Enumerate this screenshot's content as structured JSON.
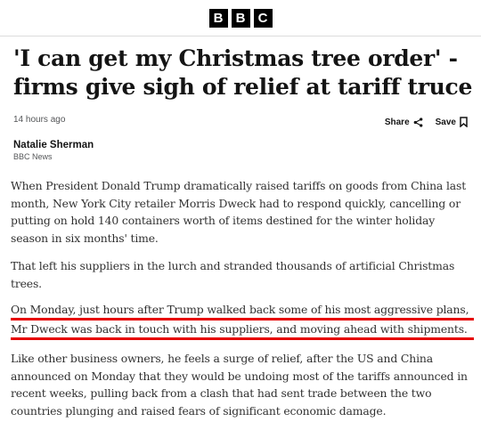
{
  "header": {
    "logo_letters": [
      "B",
      "B",
      "C"
    ]
  },
  "article": {
    "headline_line1": "'I can get my Christmas tree order' -",
    "headline_line2": "firms give sigh of relief at tariff truce",
    "timestamp": "14 hours ago",
    "share_label": "Share",
    "save_label": "Save",
    "author": "Natalie Sherman",
    "organisation": "BBC News",
    "paragraphs": [
      "When President Donald Trump dramatically raised tariffs on goods from China last month, New York City retailer Morris Dweck had to respond quickly, cancelling or putting on hold 140 containers worth of items destined for the winter holiday season in six months' time.",
      "That left his suppliers in the lurch and stranded thousands of artificial Christmas trees.",
      "Like other business owners, he feels a surge of relief, after the US and China announced on Monday that they would be undoing most of the tariffs announced in recent weeks, pulling back from a clash that had sent trade between the two countries plunging and raised fears of significant economic damage."
    ],
    "highlighted_line1": "On Monday, just hours after Trump walked back some of his most aggressive plans,",
    "highlighted_line2": "Mr Dweck was back in touch with his suppliers, and moving ahead with shipments.",
    "highlight_color": "#e60000"
  },
  "icons": {
    "share": "share-icon",
    "save": "bookmark-icon"
  }
}
